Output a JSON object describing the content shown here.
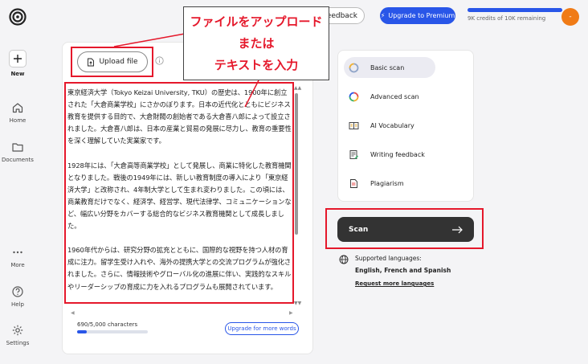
{
  "topbar": {
    "feedback_label": "Feedback",
    "premium_label": "Upgrade to Premium",
    "credits_text": "9K credits of 10K remaining",
    "avatar_initial": "-"
  },
  "nav": {
    "new_label": "New",
    "home_label": "Home",
    "documents_label": "Documents",
    "more_label": "More",
    "help_label": "Help",
    "settings_label": "Settings"
  },
  "editor": {
    "upload_label": "Upload file",
    "paragraphs": [
      "東京経済大学（Tokyo Keizai University, TKU）の歴史は、1900年に創立された「大倉商業学校」にさかのぼります。日本の近代化とともにビジネス教育を提供する目的で、大倉財閥の創始者である大倉喜八郎によって設立されました。大倉喜八郎は、日本の産業と貿易の発展に尽力し、教育の重要性を深く理解していた実業家です。",
      "1928年には、「大倉高等商業学校」として発展し、商業に特化した教育機関となりました。戦後の1949年には、新しい教育制度の導入により「東京経済大学」と改称され、4年制大学として生まれ変わりました。この頃には、商業教育だけでなく、経済学、経営学、現代法律学、コミュニケーションなど、幅広い分野をカバーする総合的なビジネス教育機関として成長しました。",
      "1960年代からは、研究分野の拡充とともに、国際的な視野を持つ人材の育成に注力。留学生受け入れや、海外の提携大学との交流プログラムが強化されました。さらに、情報技術やグローバル化の進展に伴い、実践的なスキルやリーダーシップの育成に力を入れるプログラムも展開されています。"
    ],
    "char_count": "690/5,000 characters",
    "char_fraction": 0.138,
    "upgrade_words_label": "Upgrade for more words"
  },
  "scan_options": [
    {
      "label": "Basic scan",
      "icon": "basic-scan-icon",
      "active": true
    },
    {
      "label": "Advanced scan",
      "icon": "advanced-scan-icon",
      "active": false
    },
    {
      "label": "AI Vocabulary",
      "icon": "ai-vocabulary-icon",
      "active": false
    },
    {
      "label": "Writing feedback",
      "icon": "writing-feedback-icon",
      "active": false
    },
    {
      "label": "Plagiarism",
      "icon": "plagiarism-icon",
      "active": false
    }
  ],
  "scan": {
    "label": "Scan",
    "supported_title": "Supported languages:",
    "languages": "English, French and Spanish",
    "request_link": "Request more languages"
  },
  "annotation": {
    "line1": "ファイルをアップロード",
    "line2": "または",
    "line3": "テキストを入力"
  },
  "colors": {
    "accent": "#2956e8",
    "annotation_red": "#e5182b",
    "avatar": "#f07b16",
    "scan_button": "#333333"
  }
}
